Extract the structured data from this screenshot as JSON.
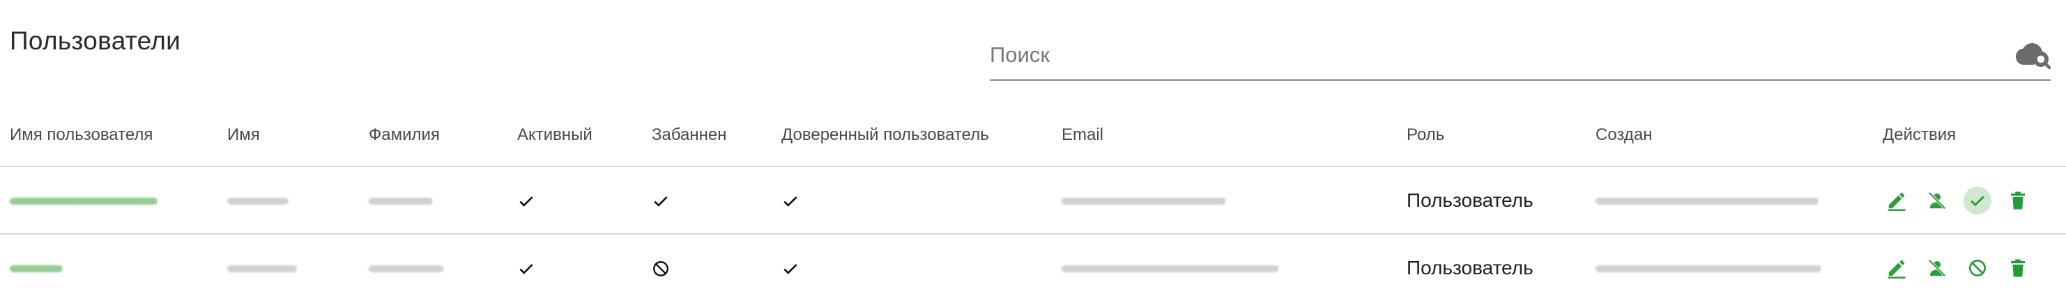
{
  "page": {
    "title": "Пользователи"
  },
  "search": {
    "placeholder": "Поиск",
    "icon": "cloud-search-icon"
  },
  "table": {
    "columns": [
      "Имя пользователя",
      "Имя",
      "Фамилия",
      "Активный",
      "Забаннен",
      "Доверенный пользователь",
      "Email",
      "Роль",
      "Создан",
      "Действия"
    ],
    "rows": [
      {
        "active": "check",
        "banned": "check",
        "trusted": "check",
        "role": "Пользователь",
        "ban_action": "check-circle-icon"
      },
      {
        "active": "check",
        "banned": "block",
        "trusted": "check",
        "role": "Пользователь",
        "ban_action": "block-icon"
      }
    ]
  },
  "colors": {
    "accent": "#2e9e3a",
    "delete": "#1f9d36",
    "text": "#212121",
    "divider": "#dcdcdc"
  }
}
